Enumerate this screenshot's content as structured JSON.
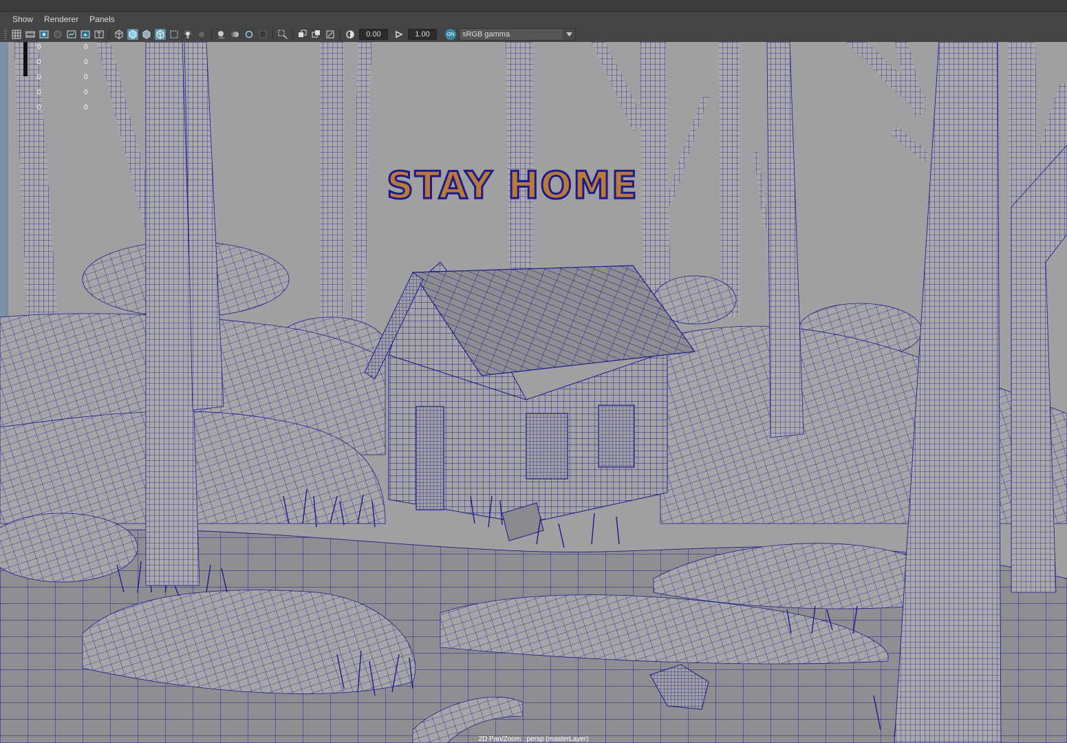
{
  "menubar": {
    "items": [
      {
        "label": "Show"
      },
      {
        "label": "Renderer"
      },
      {
        "label": "Panels"
      }
    ]
  },
  "toolbar": {
    "icons": [
      "grid-icon",
      "film-gate-icon",
      "resolution-gate-icon",
      "gate-mask-icon",
      "field-chart-icon",
      "safe-action-icon",
      "safe-title-icon",
      "wireframe-cube-icon",
      "smooth-shade-icon",
      "wireframe-on-shaded-icon",
      "textured-icon",
      "xray-icon",
      "lights-icon",
      "shadows-icon",
      "ambient-occlusion-icon",
      "motion-blur-icon",
      "anti-aliasing-icon",
      "depth-of-field-icon",
      "isolate-select-icon",
      "xray-joints-icon",
      "xray-active-icon",
      "backface-culling-icon",
      "exposure-icon",
      "gamma-icon"
    ],
    "exposure_value": "0.00",
    "gamma_value": "1.00",
    "color_mgmt_badge": "ON",
    "color_space": "sRGB gamma"
  },
  "hud": {
    "rows": [
      {
        "a": "0",
        "b": "0"
      },
      {
        "a": "0",
        "b": "0"
      },
      {
        "a": "0",
        "b": "0"
      },
      {
        "a": "0",
        "b": "0"
      },
      {
        "a": "0",
        "b": "0"
      }
    ]
  },
  "scene": {
    "sign_text": "STAY HOME",
    "wire_color": "#1a1a8c",
    "mesh_color": "#9a9a9a"
  },
  "status": {
    "camera_label": "2D Pan/Zoom : persp (masterLayer)"
  }
}
